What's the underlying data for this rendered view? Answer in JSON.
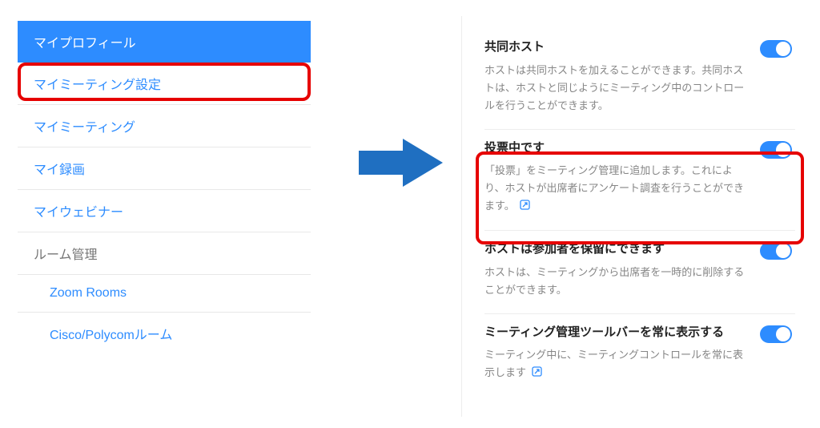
{
  "sidebar": {
    "items": [
      {
        "label": "マイプロフィール"
      },
      {
        "label": "マイミーティング設定"
      },
      {
        "label": "マイミーティング"
      },
      {
        "label": "マイ録画"
      },
      {
        "label": "マイウェビナー"
      },
      {
        "label": "ルーム管理"
      },
      {
        "label": "Zoom Rooms"
      },
      {
        "label": "Cisco/Polycomルーム"
      }
    ]
  },
  "settings": [
    {
      "title": "共同ホスト",
      "desc": "ホストは共同ホストを加えることができます。共同ホストは、ホストと同じようにミーティング中のコントロールを行うことができます。",
      "on": true,
      "link": false
    },
    {
      "title": "投票中です",
      "desc": "「投票」をミーティング管理に追加します。これにより、ホストが出席者にアンケート調査を行うことができます。",
      "on": true,
      "link": true
    },
    {
      "title": "ホストは参加者を保留にできます",
      "desc": "ホストは、ミーティングから出席者を一時的に削除することができます。",
      "on": true,
      "link": false
    },
    {
      "title": "ミーティング管理ツールバーを常に表示する",
      "desc": "ミーティング中に、ミーティングコントロールを常に表示します",
      "on": true,
      "link": true
    }
  ],
  "colors": {
    "accent": "#2d8cff",
    "highlight": "#e60000",
    "arrow": "#1f6fc1"
  }
}
